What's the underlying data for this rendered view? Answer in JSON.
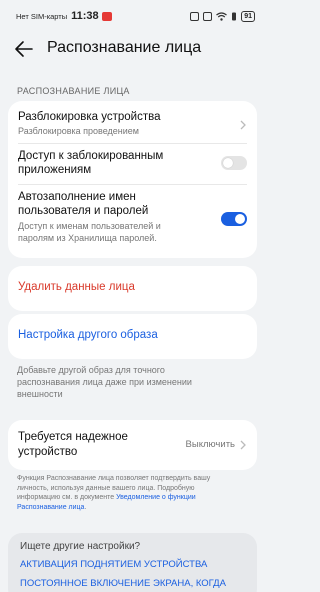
{
  "status": {
    "carrier": "Нет SIM-карты",
    "time": "11:38",
    "battery": "91"
  },
  "header": {
    "title": "Распознавание лица"
  },
  "section": {
    "label": "РАСПОЗНАВАНИЕ ЛИЦА"
  },
  "unlock": {
    "title": "Разблокировка устройства",
    "subtitle": "Разблокировка проведением"
  },
  "locked_apps": {
    "title_line1": "Доступ к заблокированным",
    "title_line2": "приложениям",
    "enabled": false
  },
  "autofill": {
    "title_line1": "Автозаполнение имен",
    "title_line2": "пользователя и паролей",
    "sub_line1": "Доступ к именам пользователей и",
    "sub_line2": "паролям из Хранилища паролей.",
    "enabled": true
  },
  "delete": {
    "label": "Удалить данные лица"
  },
  "alternate": {
    "label": "Настройка другого образа",
    "helper_line1": "Добавьте другой образ для точного",
    "helper_line2": "распознавания лица даже при изменении",
    "helper_line3": "внешности"
  },
  "trusted": {
    "title_line1": "Требуется надежное",
    "title_line2": "устройство",
    "value": "Выключить"
  },
  "footnote": {
    "line1": "Функция Распознавание лица позволяет подтвердить вашу",
    "line2": "личность, используя данные вашего лица. Подробную",
    "line3": "информацию см. в документе ",
    "link1": "Уведомление о функции",
    "link2": "Распознавание лица",
    "end": "."
  },
  "more": {
    "title": "Ищете другие настройки?",
    "link1": "АКТИВАЦИЯ ПОДНЯТИЕМ УСТРОЙСТВА",
    "link2": "ПОСТОЯННОЕ ВКЛЮЧЕНИЕ ЭКРАНА, КОГДА"
  },
  "colors": {
    "accent": "#1a5fe0",
    "danger": "#d93a2b",
    "background": "#f1f3f5"
  }
}
